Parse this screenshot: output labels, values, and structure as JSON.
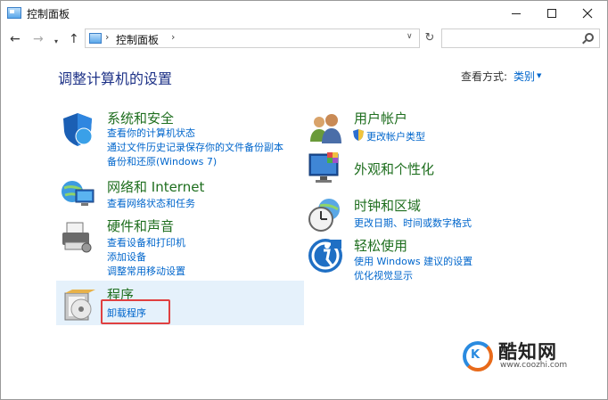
{
  "window": {
    "title": "控制面板"
  },
  "navbar": {
    "back": "←",
    "forward": "→",
    "recent": "▾",
    "up": "↑",
    "address_sep": "›",
    "address": "控制面板",
    "address_sep2": "›",
    "address_dropdown": "∨",
    "refresh": "↻"
  },
  "content": {
    "heading": "调整计算机的设置",
    "view_by_label": "查看方式:",
    "view_by_value": "类别",
    "view_by_caret": "▼"
  },
  "categories": {
    "system": {
      "title": "系统和安全",
      "links": [
        "查看你的计算机状态",
        "通过文件历史记录保存你的文件备份副本",
        "备份和还原(Windows 7)"
      ]
    },
    "network": {
      "title": "网络和 Internet",
      "links": [
        "查看网络状态和任务"
      ]
    },
    "hardware": {
      "title": "硬件和声音",
      "links": [
        "查看设备和打印机",
        "添加设备",
        "调整常用移动设置"
      ]
    },
    "programs": {
      "title": "程序",
      "links": [
        "卸载程序"
      ]
    },
    "users": {
      "title": "用户帐户",
      "links": [
        "更改帐户类型"
      ]
    },
    "appearance": {
      "title": "外观和个性化",
      "links": []
    },
    "clock": {
      "title": "时钟和区域",
      "links": [
        "更改日期、时间或数字格式"
      ]
    },
    "ease": {
      "title": "轻松使用",
      "links": [
        "使用 Windows 建议的设置",
        "优化视觉显示"
      ]
    }
  },
  "watermark": {
    "logo_text": "K",
    "brand": "酷知网",
    "url": "www.coozhi.com"
  },
  "colors": {
    "category_title": "#1e6e1e",
    "link": "#0066cc",
    "heading": "#1e3287",
    "highlight": "#e5f1fb",
    "annotation": "#e04040"
  }
}
